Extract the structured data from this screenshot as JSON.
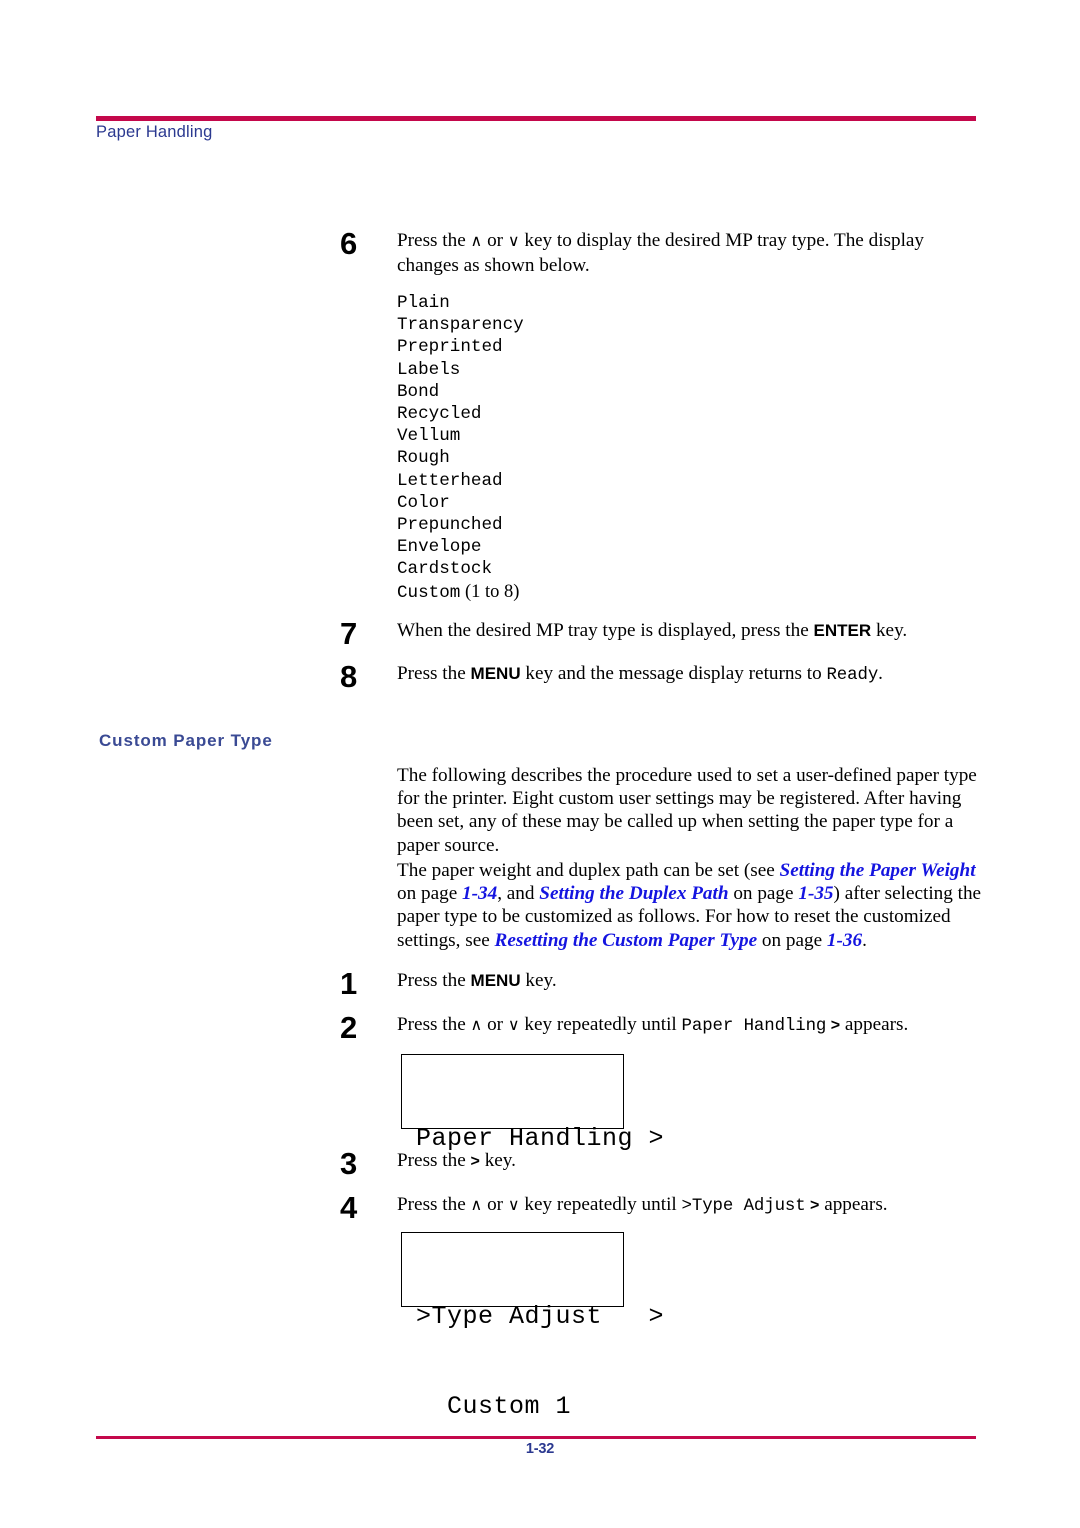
{
  "header": {
    "title": "Paper Handling",
    "rule_color": "#c4084b"
  },
  "footer": {
    "page_number": "1-32",
    "rule_color": "#c4084b"
  },
  "steps_first_group": [
    {
      "number": "6",
      "text_before_up": "Press the ",
      "up_arrow": "∧",
      "or_text": " or ",
      "down_arrow": "∨",
      "text_after": " key to display the desired MP tray type. The display changes as shown below."
    },
    {
      "number": "7",
      "pre": "When the desired MP tray type is displayed, press the ",
      "key": "ENTER",
      "post": " key."
    },
    {
      "number": "8",
      "pre": "Press the ",
      "key": "MENU",
      "mid": " key and the message display returns to ",
      "mono": "Ready",
      "post": "."
    }
  ],
  "paper_types": [
    "Plain",
    "Transparency",
    "Preprinted",
    "Labels",
    "Bond",
    "Recycled",
    "Vellum",
    "Rough",
    "Letterhead",
    "Color",
    "Prepunched",
    "Envelope",
    "Cardstock"
  ],
  "paper_type_custom": {
    "mono": "Custom",
    "suffix": " (1 to 8)"
  },
  "section": {
    "heading": "Custom Paper Type",
    "paragraph1": "The following describes the procedure used to set a user-defined paper type for the printer. Eight custom user settings may be registered. After having been set, any of these may be called up when setting the paper type for a paper source.",
    "paragraph2": {
      "p1": "The paper weight and duplex path can be set (see ",
      "xref1": "Setting the Paper Weight",
      "p2": " on page ",
      "page1": "1-34",
      "p3": ", and ",
      "xref2": "Setting the Duplex Path",
      "p4": " on page ",
      "page2": "1-35",
      "p5": ") after selecting the paper type to be customized as follows. For how to reset the customized settings, see ",
      "xref3": "Resetting the Custom Paper Type",
      "p6": " on page ",
      "page3": "1-36",
      "p7": "."
    }
  },
  "steps_second_group": [
    {
      "number": "1",
      "pre": "Press the ",
      "key": "MENU",
      "post": " key."
    },
    {
      "number": "2",
      "pre": "Press the ",
      "up_arrow": "∧",
      "or_text": " or ",
      "down_arrow": "∨",
      "mid": " key repeatedly until ",
      "mono": "Paper Handling",
      "gt": " >",
      "post": " appears."
    },
    {
      "number": "3",
      "pre": "Press the ",
      "gt": ">",
      "post": " key."
    },
    {
      "number": "4",
      "pre": "Press the ",
      "up_arrow": "∧",
      "or_text": " or ",
      "down_arrow": "∨",
      "mid": " key repeatedly until ",
      "mono": ">Type Adjust",
      "gt": " >",
      "post": " appears."
    }
  ],
  "lcd_displays": [
    {
      "line1": "Paper Handling >",
      "line2": ""
    },
    {
      "line1": ">Type Adjust   >",
      "line2": "  Custom 1"
    }
  ]
}
